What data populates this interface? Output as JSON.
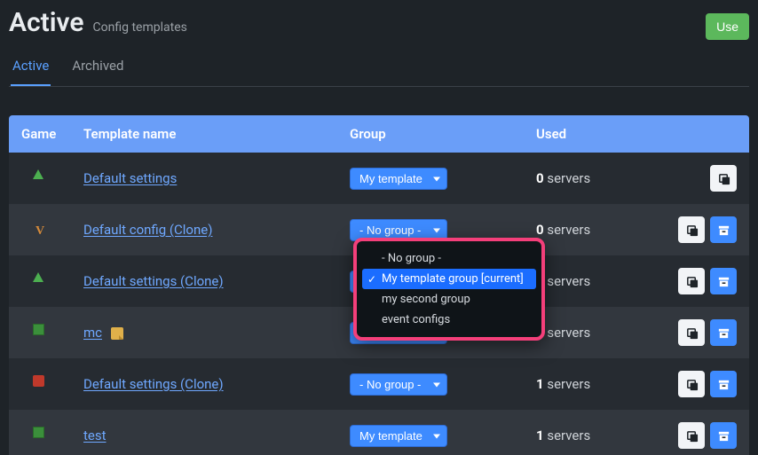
{
  "header": {
    "title": "Active",
    "subtitle": "Config templates",
    "use_button": "Use"
  },
  "tabs": {
    "active": "Active",
    "archived": "Archived"
  },
  "columns": {
    "game": "Game",
    "name": "Template name",
    "group": "Group",
    "used": "Used"
  },
  "group_options": {
    "my_template": "My template",
    "no_group": "- No group -"
  },
  "rows": [
    {
      "game": "ark",
      "name": "Default settings",
      "group": "my_template",
      "used_n": "0",
      "used_label": "servers",
      "has_note": false,
      "has_archive": false
    },
    {
      "game": "val",
      "name": "Default config (Clone)",
      "group": "no_group",
      "used_n": "0",
      "used_label": "servers",
      "has_note": false,
      "has_archive": true
    },
    {
      "game": "ark",
      "name": "Default settings (Clone)",
      "group": "my_template",
      "used_n": "1",
      "used_label": "servers",
      "has_note": false,
      "has_archive": true
    },
    {
      "game": "mc",
      "name": "mc",
      "group": "my_template",
      "used_n": "1",
      "used_label": "servers",
      "has_note": true,
      "has_archive": true
    },
    {
      "game": "rust",
      "name": "Default settings (Clone)",
      "group": "no_group",
      "used_n": "1",
      "used_label": "servers",
      "has_note": false,
      "has_archive": true
    },
    {
      "game": "mc",
      "name": "test",
      "group": "my_template",
      "used_n": "1",
      "used_label": "servers",
      "has_note": false,
      "has_archive": true
    }
  ],
  "dropdown": {
    "items": [
      "- No group -",
      "My template group [current]",
      "my second group",
      "event configs"
    ],
    "selected_index": 1
  }
}
